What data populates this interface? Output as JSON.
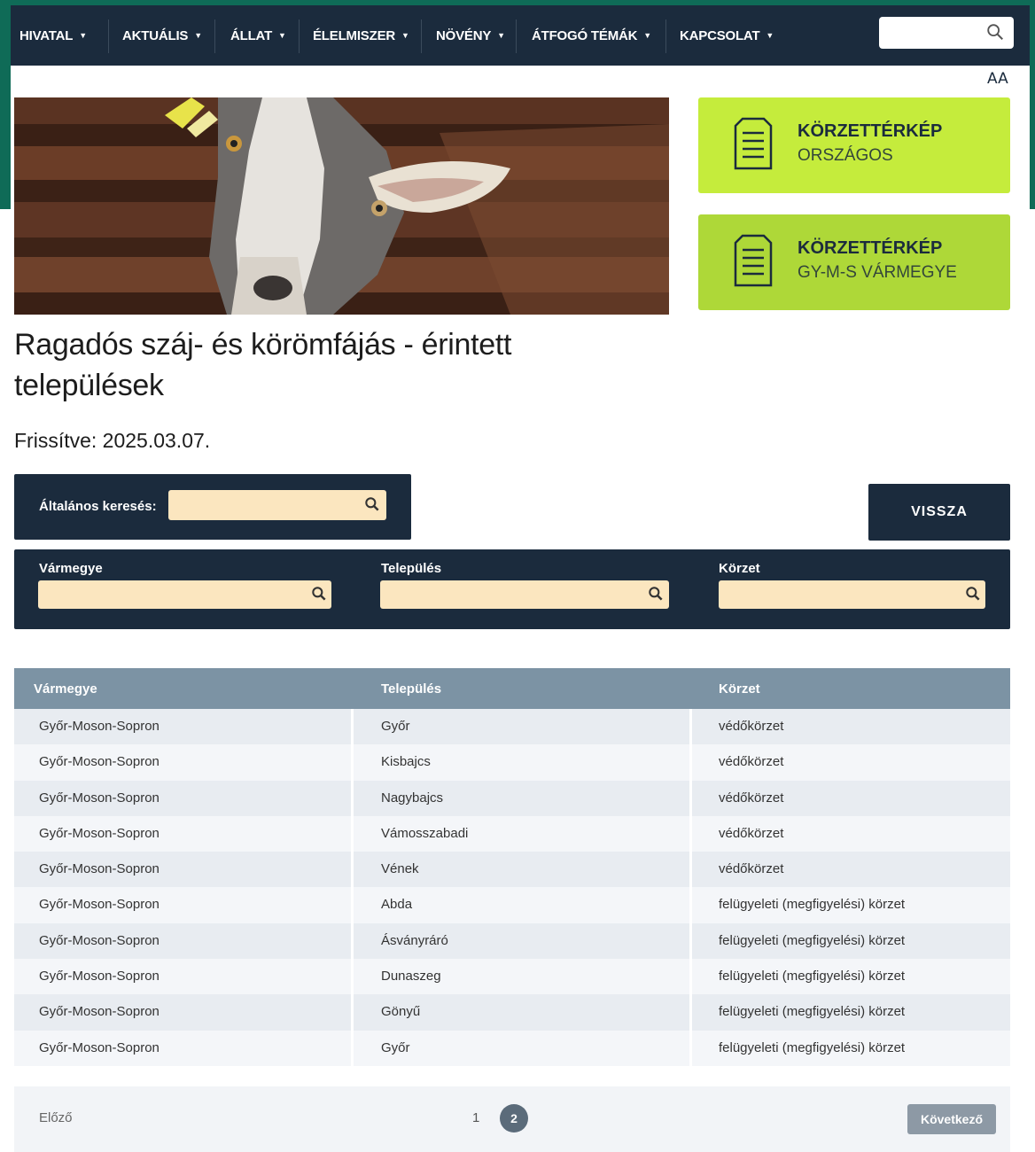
{
  "nav": {
    "items": [
      {
        "label": "HIVATAL"
      },
      {
        "label": "AKTUÁLIS"
      },
      {
        "label": "ÁLLAT"
      },
      {
        "label": "ÉLELMISZER"
      },
      {
        "label": "NÖVÉNY"
      },
      {
        "label": "ÁTFOGÓ TÉMÁK"
      },
      {
        "label": "KAPCSOLAT"
      }
    ],
    "search_value": "",
    "font_size_toggle": "AA"
  },
  "cards": [
    {
      "title": "KÖRZETTÉRKÉP",
      "subtitle": "ORSZÁGOS",
      "color": "#c5ec3c"
    },
    {
      "title": "KÖRZETTÉRKÉP",
      "subtitle": "GY-M-S VÁRMEGYE",
      "color": "#aed838"
    }
  ],
  "page": {
    "title": "Ragadós száj- és körömfájás - érintett települések",
    "updated": "Frissítve: 2025.03.07."
  },
  "search": {
    "general_label": "Általános keresés:",
    "back_label": "VISSZA",
    "filters": [
      "Vármegye",
      "Település",
      "Körzet"
    ]
  },
  "table": {
    "headers": [
      "Vármegye",
      "Település",
      "Körzet"
    ],
    "rows": [
      [
        "Győr-Moson-Sopron",
        "Győr",
        "védőkörzet"
      ],
      [
        "Győr-Moson-Sopron",
        "Kisbajcs",
        "védőkörzet"
      ],
      [
        "Győr-Moson-Sopron",
        "Nagybajcs",
        "védőkörzet"
      ],
      [
        "Győr-Moson-Sopron",
        "Vámosszabadi",
        "védőkörzet"
      ],
      [
        "Győr-Moson-Sopron",
        "Vének",
        "védőkörzet"
      ],
      [
        "Győr-Moson-Sopron",
        "Abda",
        "felügyeleti (megfigyelési) körzet"
      ],
      [
        "Győr-Moson-Sopron",
        "Ásványráró",
        "felügyeleti (megfigyelési) körzet"
      ],
      [
        "Győr-Moson-Sopron",
        "Dunaszeg",
        "felügyeleti (megfigyelési) körzet"
      ],
      [
        "Győr-Moson-Sopron",
        "Gönyű",
        "felügyeleti (megfigyelési) körzet"
      ],
      [
        "Győr-Moson-Sopron",
        "Győr",
        "felügyeleti (megfigyelési) körzet"
      ]
    ]
  },
  "pagination": {
    "prev": "Előző",
    "pages": [
      "1",
      "2"
    ],
    "current": "2",
    "next": "Következő"
  },
  "colors": {
    "navy": "#1b2b3d",
    "green_frame": "#0f6b57",
    "input_tan": "#fbe6bf",
    "table_header": "#7c93a4"
  }
}
